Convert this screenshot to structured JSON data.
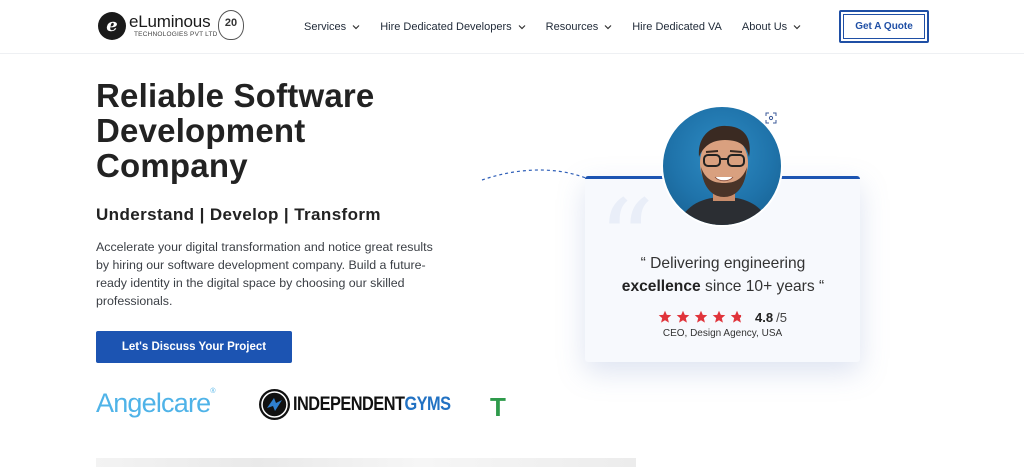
{
  "header": {
    "logo": {
      "name": "eLuminous",
      "tagline": "TECHNOLOGIES PVT LTD",
      "badge": "20",
      "mark": "e"
    },
    "nav": [
      {
        "label": "Services",
        "has_dropdown": true
      },
      {
        "label": "Hire Dedicated Developers",
        "has_dropdown": true
      },
      {
        "label": "Resources",
        "has_dropdown": true
      },
      {
        "label": "Hire Dedicated VA",
        "has_dropdown": false
      },
      {
        "label": "About Us",
        "has_dropdown": true
      }
    ],
    "cta_label": "Get A Quote"
  },
  "hero": {
    "title": "Reliable Software Development Company",
    "tagline": "Understand | Develop | Transform",
    "description": "Accelerate your digital transformation and notice great results by hiring our software development company. Build a future-ready identity in the digital space by choosing our skilled professionals.",
    "cta_label": "Let's Discuss Your Project"
  },
  "clients": [
    {
      "name": "Angelcare"
    },
    {
      "name_prefix": "INDEPENDENT",
      "name_suffix": "GYMS"
    },
    {
      "name": "T"
    }
  ],
  "testimonial": {
    "quote_open": "“ Delivering engineering",
    "quote_bold": "excellence",
    "quote_close": " since 10+ years “",
    "rating": "4.8",
    "rating_scale": "/5",
    "stars_value": 4.8,
    "reviewer": "CEO, Design Agency, USA"
  },
  "colors": {
    "brand_blue": "#1c54b2",
    "star_red": "#e0343b",
    "angelcare_blue": "#4fb3e8",
    "gyms_blue": "#2272c3",
    "green": "#2e9a4b"
  },
  "icons": [
    "chevron-down-icon",
    "star-icon",
    "scan-icon",
    "dashed-arrow-icon",
    "quote-mark-icon"
  ]
}
